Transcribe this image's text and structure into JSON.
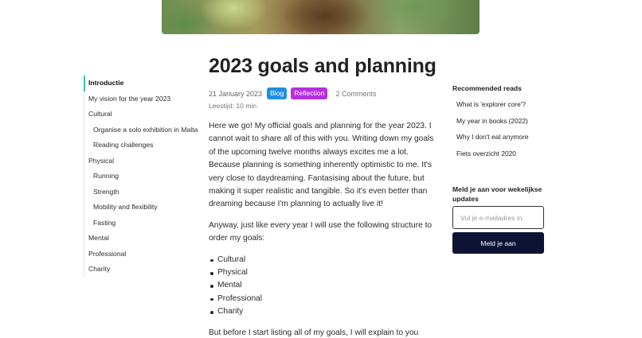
{
  "article": {
    "title": "2023 goals and planning",
    "date": "21 January 2023",
    "tags": [
      "Blog",
      "Reflection"
    ],
    "comments": "2 Comments",
    "read_time": "Leestijd: 10 min",
    "paragraphs": [
      "Here we go! My official goals and planning for the year 2023. I cannot wait to share all of this with you. Writing down my goals of the upcoming twelve months always excites me a lot. Because planning is something inherently optimistic to me. It's very close to daydreaming. Fantasising about the future, but making it super realistic and tangible. So it's even better than dreaming because I'm planning to actually live it!",
      "Anyway, just like every year I will use the following structure to order my goals:"
    ],
    "list": [
      "Cultural",
      "Physical",
      "Mental",
      "Professional",
      "Charity"
    ],
    "trailing": "But before I start listing all of my goals, I will explain to you"
  },
  "toc": {
    "items": [
      {
        "label": "Introductie"
      },
      {
        "label": "My vision for the year 2023"
      },
      {
        "label": "Cultural"
      },
      {
        "label": "Organise a solo exhibition in Malta"
      },
      {
        "label": "Reading challenges"
      },
      {
        "label": "Physical"
      },
      {
        "label": "Running"
      },
      {
        "label": "Strength"
      },
      {
        "label": "Mobility and flexibility"
      },
      {
        "label": "Fasting"
      },
      {
        "label": "Mental"
      },
      {
        "label": "Professional"
      },
      {
        "label": "Charity"
      }
    ]
  },
  "sidebar": {
    "recommended_title": "Recommended reads",
    "recommended": [
      {
        "label": "What is 'explorer core'?"
      },
      {
        "label": "My year in books (2022)"
      },
      {
        "label": "Why I don't eat anymore"
      },
      {
        "label": "Fiets overzicht 2020"
      }
    ],
    "newsletter_title": "Meld je aan voor wekelijkse updates",
    "email_placeholder": "Vul je e-mailadres in",
    "submit_label": "Meld je aan"
  },
  "colors": {
    "blog_badge": "#1d8fe6",
    "reflection_badge": "#b530e0",
    "toc_active": "#3ac3a5",
    "button": "#0d1333"
  }
}
